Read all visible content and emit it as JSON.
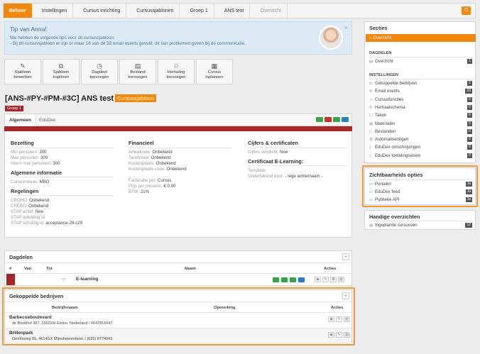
{
  "breadcrumb": [
    "Beheer",
    "Instellingen",
    "Cursus inrichting",
    "Cursussjablonen",
    "Groep 1",
    "ANS test",
    "Overzicht"
  ],
  "tip": {
    "title": "Tip van Anna!",
    "lines": [
      "We hebben de volgende tips voor dit cursussjabloon:",
      "- Bij dit cursussjabloon er zijn er maar 16 van de 33 email events gevuld, dit kan problemen geven bij de communicatie."
    ],
    "close": "×"
  },
  "toolbar": [
    {
      "icon": "edit-icon",
      "glyph": "✎",
      "label": [
        "Sjabloon",
        "bewerken"
      ]
    },
    {
      "icon": "copy-icon",
      "glyph": "⧉",
      "label": [
        "Sjabloon",
        "kopiëren"
      ]
    },
    {
      "icon": "clock-icon",
      "glyph": "◷",
      "label": [
        "Dagdeel",
        "toevoegen"
      ]
    },
    {
      "icon": "file-icon",
      "glyph": "▤",
      "label": [
        "Bestand",
        "toevoegen"
      ]
    },
    {
      "icon": "recycle-icon",
      "glyph": "♲",
      "label": [
        "Herhaling",
        "toevoegen"
      ]
    },
    {
      "icon": "calendar-icon",
      "glyph": "▦",
      "label": [
        "Cursus",
        "inplannen"
      ]
    }
  ],
  "page_title": "[ANS-#PY-#PM-#3C] ANS test",
  "page_badge": "Cursussjabloon",
  "group_badge": "Groep 1",
  "tabs": [
    "Algemeen",
    "EduDex"
  ],
  "sections": {
    "bezetting": {
      "title": "Bezetting",
      "rows": [
        {
          "label": "Min personen:",
          "value": "300"
        },
        {
          "label": "Max personen:",
          "value": "300"
        },
        {
          "label": "Intern max personen:",
          "value": "300"
        }
      ]
    },
    "algemeen": {
      "title": "Algemene informatie",
      "rows": [
        {
          "label": "Cursusniveau:",
          "value": "MBO"
        }
      ]
    },
    "regelingen": {
      "title": "Regelingen",
      "rows": [
        {
          "label": "CROHO:",
          "value": "Onbekend"
        },
        {
          "label": "CREBO:",
          "value": "Onbekend"
        },
        {
          "label": "STAP actief:",
          "value": "Nee"
        },
        {
          "label": "STAP opleiding id:",
          "value": ""
        },
        {
          "label": "STAP scholing id:",
          "value": "acceptance-29-c29"
        }
      ]
    },
    "financieel": {
      "title": "Financieel",
      "rows": [
        {
          "label": "Artikelcode:",
          "value": "Onbekend"
        },
        {
          "label": "Tariefcode:",
          "value": "Onbekend"
        },
        {
          "label": "Kostenplaats:",
          "value": "Onbekend"
        },
        {
          "label": "Kostenplaats code:",
          "value": "Onbekend"
        }
      ],
      "rows2": [
        {
          "label": "Facturatie per:",
          "value": "Cursus"
        },
        {
          "label": "Prijs per persoon:",
          "value": "€ 0.00"
        },
        {
          "label": "BTW:",
          "value": "21%"
        }
      ]
    },
    "cijfers": {
      "title": "Cijfers & certificaten",
      "rows": [
        {
          "label": "Cijfers verplicht:",
          "value": "Nee"
        }
      ]
    },
    "certificaat": {
      "title": "Certificaat E-Learning:",
      "rows": [
        {
          "label": "Template:",
          "value": ""
        },
        {
          "label": "Ondertekend door:",
          "value": "- lege achternaam -"
        }
      ]
    }
  },
  "dagdelen": {
    "title": "Dagdelen",
    "plus": "+",
    "columns": [
      "#",
      "Van",
      "Tot",
      "Naam",
      "Acties"
    ],
    "row": {
      "naam": "E-learning"
    }
  },
  "gekoppelde_bedrijven": {
    "title": "Gekoppelde bedrijven",
    "plus": "+",
    "columns": [
      "Bedrijfsnaam",
      "Opmerking",
      "Acties"
    ],
    "rows": [
      {
        "name": "Barbecueboulevard",
        "address": "de Bookhof 367, 2903XH Elsloo, Nederland / 0647816047"
      },
      {
        "name": "Brillenpark",
        "address": "Gerritsweg 65, 4614GX Mijnsheerenland, / (025) 8774043"
      }
    ]
  },
  "sidebar": {
    "secties_title": "Secties",
    "active": "Overzicht",
    "dagdelen_cat": "DAGDELEN",
    "dagdelen_items": [
      {
        "label": "Overzicht",
        "count": "1"
      }
    ],
    "instellingen_cat": "INSTELLINGEN",
    "instellingen_items": [
      {
        "label": "Gekoppelde bedrijven",
        "count": "2",
        "icon": "building-icon",
        "glyph": "▭"
      },
      {
        "label": "Email events",
        "count": "16",
        "icon": "mail-icon",
        "glyph": "✉"
      },
      {
        "label": "Cursusfuncties",
        "count": "0",
        "icon": "user-icon",
        "glyph": "☺"
      },
      {
        "label": "Herhaalschema",
        "count": "0",
        "icon": "refresh-icon",
        "glyph": "↻"
      },
      {
        "label": "Taken",
        "count": "0",
        "icon": "task-icon",
        "glyph": "☐"
      },
      {
        "label": "Materialen",
        "count": "0",
        "icon": "book-icon",
        "glyph": "▤"
      },
      {
        "label": "Bestanden",
        "count": "0",
        "icon": "file-icon",
        "glyph": "▯"
      },
      {
        "label": "Automatiseringen",
        "count": "0",
        "icon": "gear-icon",
        "glyph": "⚙"
      },
      {
        "label": "EduDex omschrijvingen",
        "count": "0",
        "icon": "doc-icon",
        "glyph": "▯"
      },
      {
        "label": "EduDex toelatingseisen",
        "count": "0",
        "icon": "doc-icon",
        "glyph": "▯"
      }
    ],
    "zicht_title": "Zichtbaarheids opties",
    "zicht_items": [
      {
        "label": "Portalen",
        "count": "Ja",
        "icon": "portal-icon",
        "glyph": "▭"
      },
      {
        "label": "EduDex feed",
        "count": "Ja",
        "icon": "feed-icon",
        "glyph": "▭"
      },
      {
        "label": "Publieke API",
        "count": "Ja",
        "icon": "api-icon",
        "glyph": "▭"
      }
    ],
    "handige_title": "Handige overzichten",
    "handige_items": [
      {
        "label": "Ingeplande cursussen",
        "count": "12",
        "icon": "list-icon",
        "glyph": "▤"
      }
    ]
  },
  "colors": {
    "accent": "#f0880e",
    "danger": "#a8262a",
    "highlight": "#f19a3a"
  }
}
